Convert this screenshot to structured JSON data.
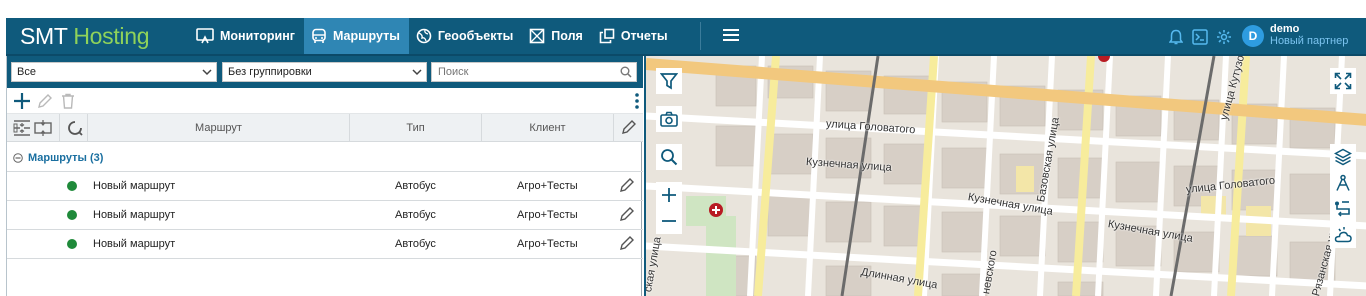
{
  "app": {
    "logo_main": "SMT",
    "logo_accent": "Hosting"
  },
  "nav": [
    {
      "label": "Мониторинг",
      "icon": "monitor-icon",
      "active": false
    },
    {
      "label": "Маршруты",
      "icon": "bus-icon",
      "active": true
    },
    {
      "label": "Геообъекты",
      "icon": "globe-icon",
      "active": false
    },
    {
      "label": "Поля",
      "icon": "field-icon",
      "active": false
    },
    {
      "label": "Отчеты",
      "icon": "reports-icon",
      "active": false
    }
  ],
  "user": {
    "initial": "D",
    "name": "demo",
    "partner": "Новый партнер"
  },
  "filters": {
    "filter1_value": "Все",
    "filter2_value": "Без группировки",
    "search_placeholder": "Поиск"
  },
  "table": {
    "columns": [
      "Маршрут",
      "Тип",
      "Клиент"
    ],
    "group_label": "Маршруты (3)",
    "rows": [
      {
        "name": "Новый маршрут",
        "type": "Автобус",
        "client": "Агро+Тесты",
        "status_color": "#1f8a3a"
      },
      {
        "name": "Новый маршрут",
        "type": "Автобус",
        "client": "Агро+Тесты",
        "status_color": "#1f8a3a"
      },
      {
        "name": "Новый маршрут",
        "type": "Автобус",
        "client": "Агро+Тесты",
        "status_color": "#1f8a3a"
      }
    ]
  },
  "map": {
    "streets": [
      "улица Головатого",
      "Кузнечная улица",
      "Кузнечная улица",
      "Кузнечная улица",
      "Базовская улица",
      "улица Головатого",
      "улица Кутузова",
      "Длинная улица",
      "ская улица",
      "невского",
      "Рязанская улица"
    ]
  },
  "colors": {
    "header": "#0f5a7c",
    "nav_active": "#2f86b4",
    "accent_green": "#8fd25a",
    "status_green": "#1f8a3a",
    "link": "#1a6fa0"
  }
}
